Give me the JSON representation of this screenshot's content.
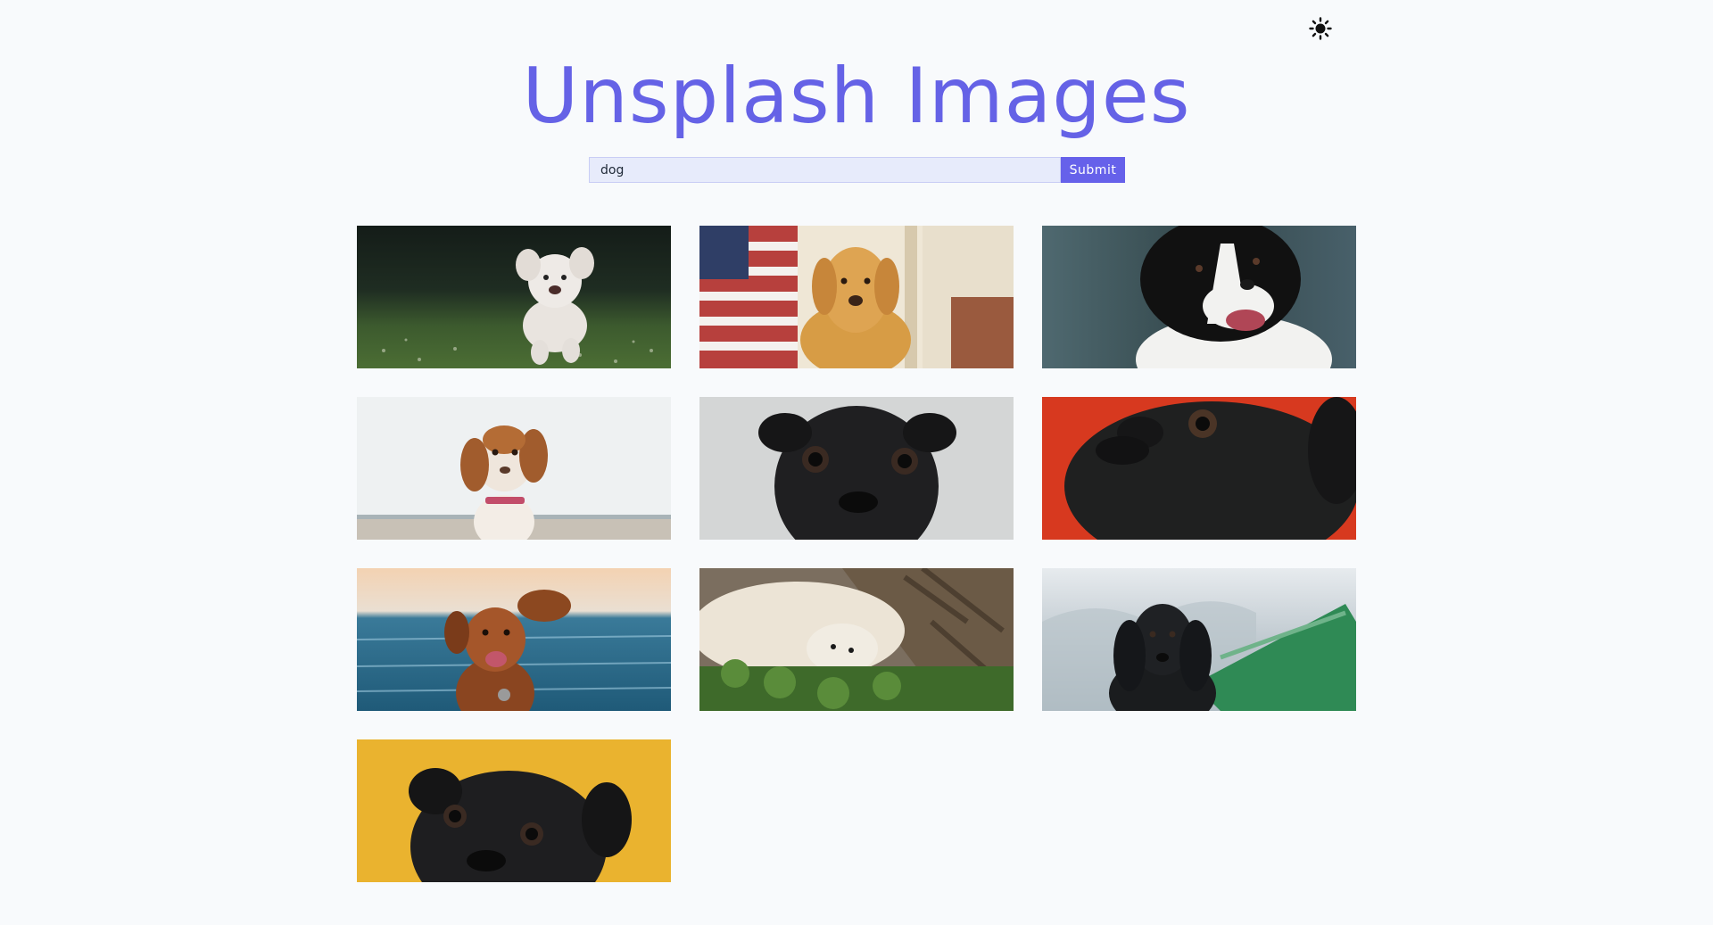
{
  "header": {
    "title": "Unsplash Images",
    "theme_toggle_icon": "sun-icon"
  },
  "search": {
    "value": "dog",
    "submit_label": "Submit"
  },
  "colors": {
    "accent": "#6661ea",
    "background": "#f8fafc"
  },
  "gallery": {
    "images": [
      {
        "subject": "white fluffy puppy running on grass"
      },
      {
        "subject": "golden retriever with american flag"
      },
      {
        "subject": "black and white border collie"
      },
      {
        "subject": "spaniel puppy on beach"
      },
      {
        "subject": "black pug on grey background"
      },
      {
        "subject": "black pug on red background"
      },
      {
        "subject": "brown dog by the sea"
      },
      {
        "subject": "dog and cat cuddling"
      },
      {
        "subject": "black cocker spaniel on green boat"
      },
      {
        "subject": "black pug on yellow background"
      }
    ]
  }
}
